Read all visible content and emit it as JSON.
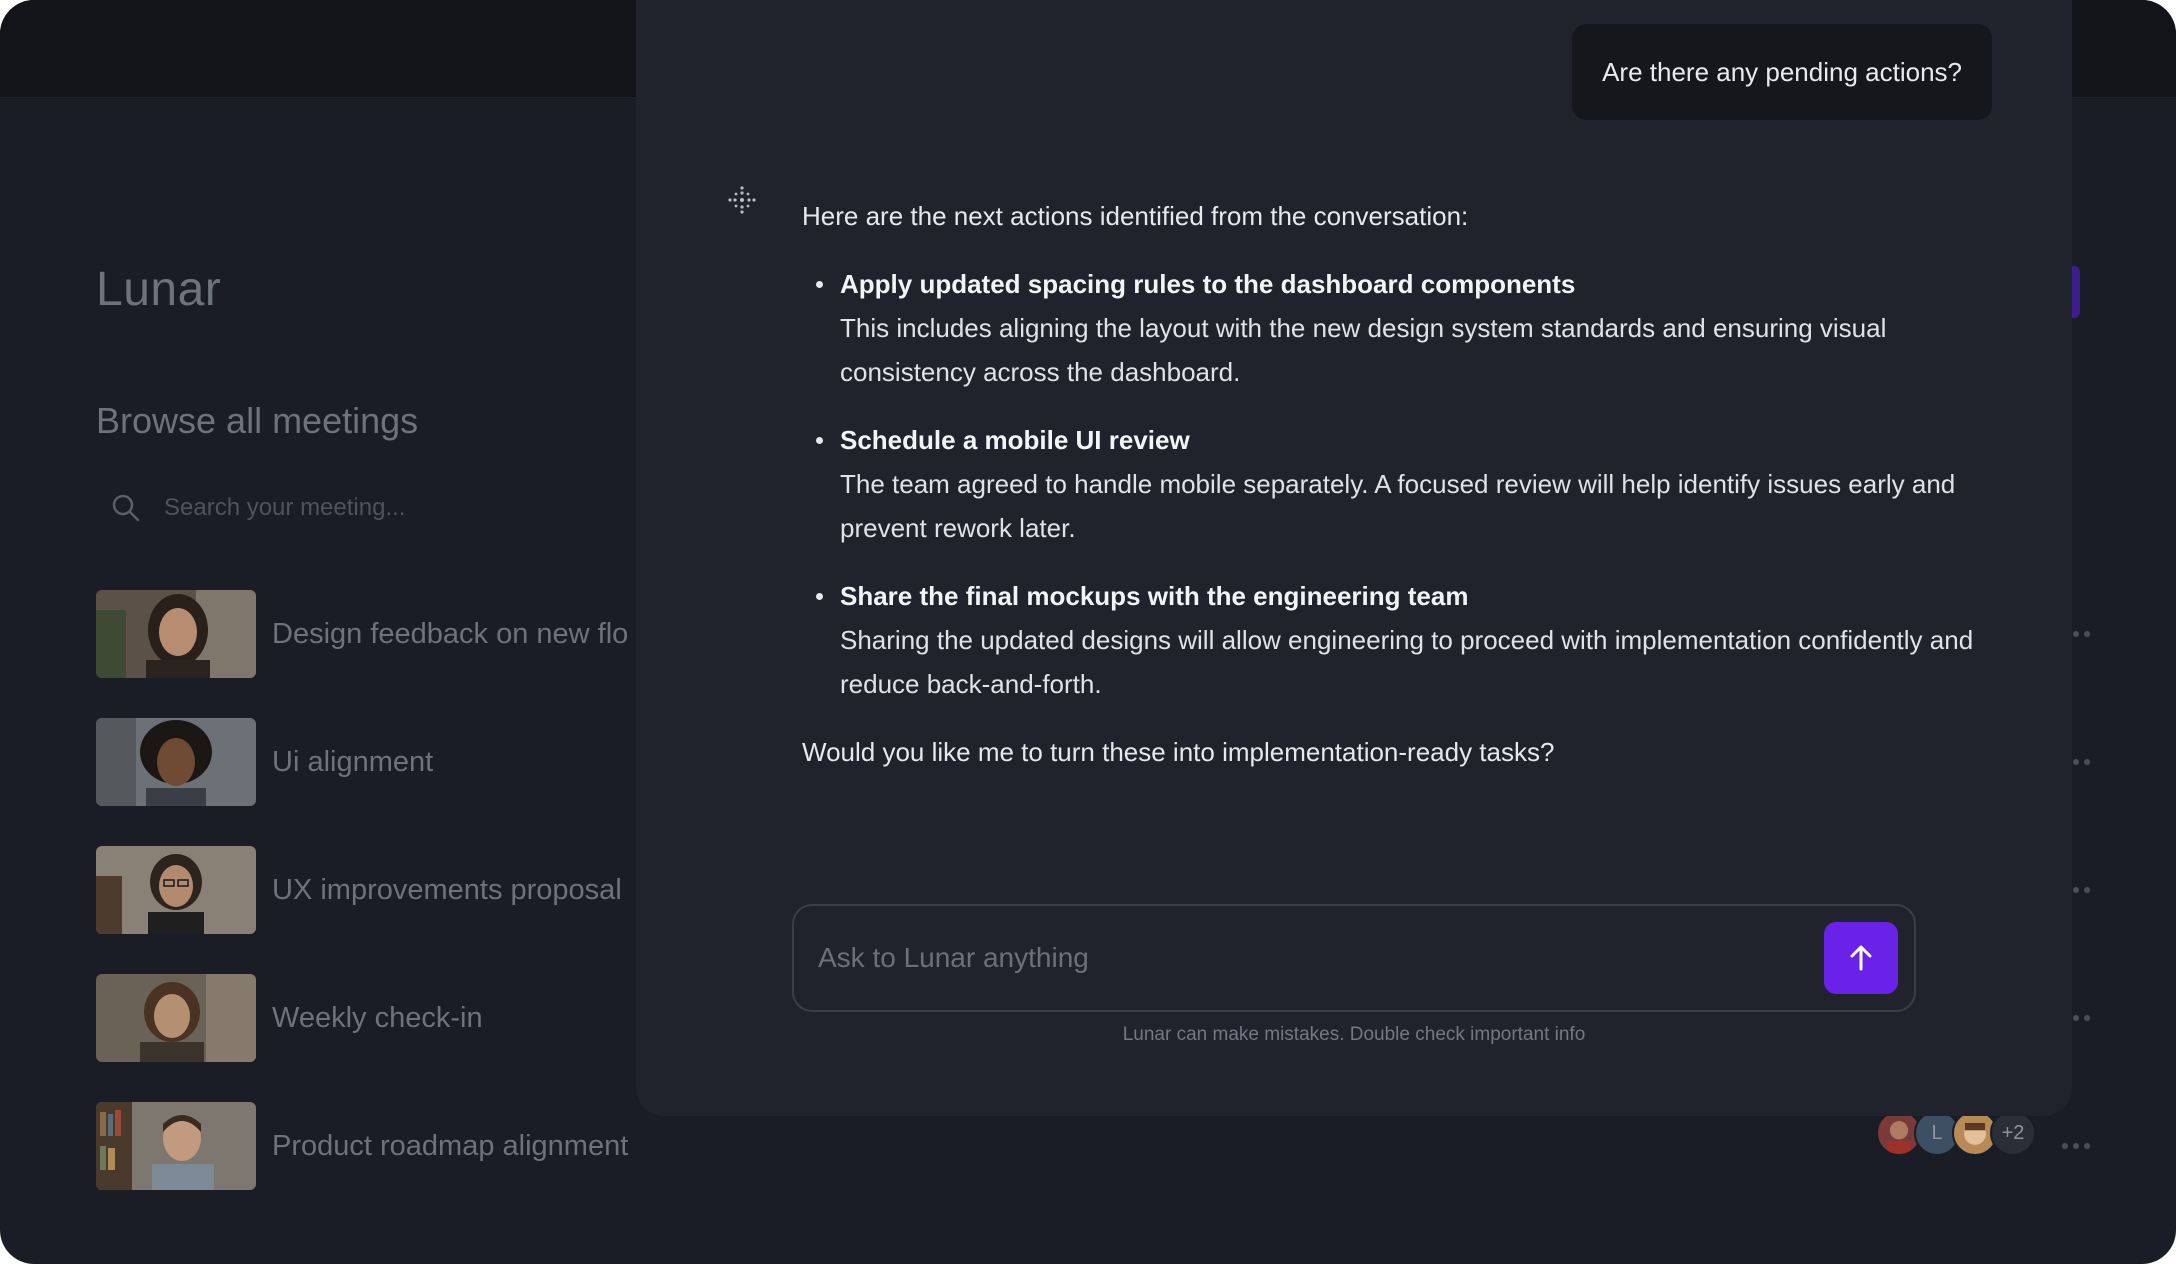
{
  "app": {
    "title": "Lunar"
  },
  "browse": {
    "title": "Browse all meetings",
    "search_placeholder": "Search your meeting..."
  },
  "meetings": [
    {
      "title": "Design feedback on new flo",
      "thumb_icon": "woman-smiling-thumbnail"
    },
    {
      "title": "Ui alignment",
      "thumb_icon": "woman-curly-hair-thumbnail"
    },
    {
      "title": "UX improvements proposal",
      "thumb_icon": "woman-glasses-thumbnail"
    },
    {
      "title": "Weekly check-in",
      "thumb_icon": "man-long-hair-thumbnail"
    },
    {
      "title": "Product roadmap alignment",
      "thumb_icon": "man-bookshelf-thumbnail",
      "participants": {
        "initial": "L",
        "extra": "+2"
      }
    }
  ],
  "chat": {
    "user_message": "Are there any pending actions?",
    "assistant": {
      "intro": "Here are the next actions identified from the conversation:",
      "actions": [
        {
          "title": "Apply updated spacing rules to the dashboard components",
          "description": "This includes aligning the layout with the new design system standards and ensuring visual consistency across the dashboard."
        },
        {
          "title": "Schedule a mobile UI review",
          "description": "The team agreed to handle mobile separately. A focused review will help identify issues early and prevent rework later."
        },
        {
          "title": "Share the final mockups with the engineering team",
          "description": "Sharing the updated designs will allow engineering to proceed with implementation confidently and reduce back-and-forth."
        }
      ],
      "outro": "Would you like me to turn these into implementation-ready tasks?"
    },
    "composer": {
      "placeholder": "Ask to Lunar anything",
      "send_icon": "arrow-up-icon"
    },
    "disclaimer": "Lunar can make mistakes. Double check important info"
  },
  "colors": {
    "accent": "#6a22e8",
    "background": "#1a1d25",
    "panel": "#20232c"
  }
}
